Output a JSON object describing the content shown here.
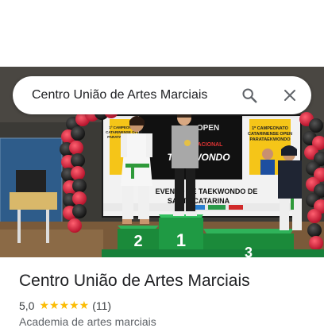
{
  "search": {
    "query": "Centro União de Artes Marciais",
    "search_icon": "search-icon",
    "close_icon": "close-icon"
  },
  "photo": {
    "banner_left": {
      "line1": "1º CAMPEONATO",
      "line2": "CATARINENSE OPEN",
      "line3": "PARATAEKWONDO"
    },
    "banner_right": {
      "line1": "1º CAMPEONATO",
      "line2": "CATARINENSE OPEN",
      "line3": "PARATAEKWONDO"
    },
    "banner_center": {
      "open": "OPEN",
      "nacional": "NACIONAL",
      "taekwondo": "TAEKWONDO",
      "evento": "EVENTO DE TAEKWONDO DE",
      "estado": "SANTA CATARINA"
    },
    "podium": {
      "first": "1",
      "second": "2",
      "third": "3"
    }
  },
  "place": {
    "name": "Centro União de Artes Marciais",
    "rating": "5,0",
    "stars": "★★★★★",
    "reviews": "(11)",
    "category": "Academia de artes marciais"
  },
  "colors": {
    "accent_star": "#fbbc04",
    "podium_green": "#1b8a3a",
    "balloon_red": "#d7263d"
  }
}
